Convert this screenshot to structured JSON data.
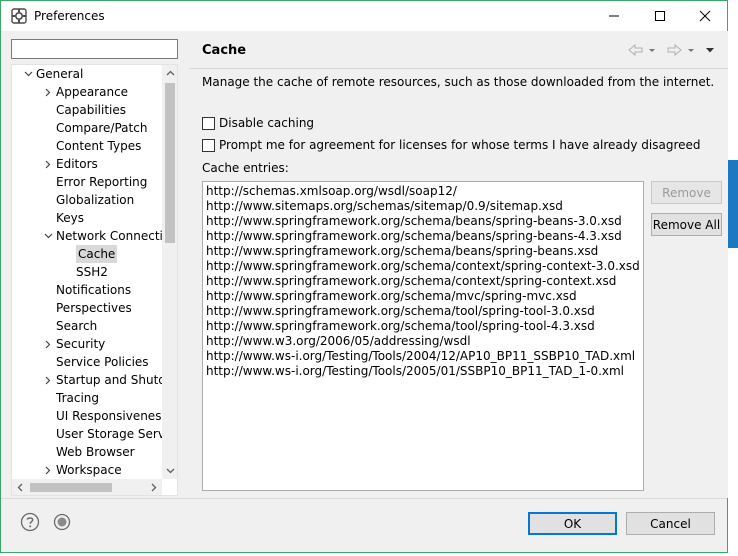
{
  "window": {
    "title": "Preferences"
  },
  "filter": {
    "value": ""
  },
  "tree": {
    "items": [
      {
        "label": "General",
        "level": 0,
        "arrow": "expanded"
      },
      {
        "label": "Appearance",
        "level": 1,
        "arrow": "collapsed"
      },
      {
        "label": "Capabilities",
        "level": 1,
        "arrow": "none"
      },
      {
        "label": "Compare/Patch",
        "level": 1,
        "arrow": "none"
      },
      {
        "label": "Content Types",
        "level": 1,
        "arrow": "none"
      },
      {
        "label": "Editors",
        "level": 1,
        "arrow": "collapsed"
      },
      {
        "label": "Error Reporting",
        "level": 1,
        "arrow": "none"
      },
      {
        "label": "Globalization",
        "level": 1,
        "arrow": "none"
      },
      {
        "label": "Keys",
        "level": 1,
        "arrow": "none"
      },
      {
        "label": "Network Connection",
        "level": 1,
        "arrow": "expanded"
      },
      {
        "label": "Cache",
        "level": 2,
        "arrow": "none",
        "selected": true
      },
      {
        "label": "SSH2",
        "level": 2,
        "arrow": "none"
      },
      {
        "label": "Notifications",
        "level": 1,
        "arrow": "none"
      },
      {
        "label": "Perspectives",
        "level": 1,
        "arrow": "none"
      },
      {
        "label": "Search",
        "level": 1,
        "arrow": "none"
      },
      {
        "label": "Security",
        "level": 1,
        "arrow": "collapsed"
      },
      {
        "label": "Service Policies",
        "level": 1,
        "arrow": "none"
      },
      {
        "label": "Startup and Shutdown",
        "level": 1,
        "arrow": "collapsed"
      },
      {
        "label": "Tracing",
        "level": 1,
        "arrow": "none"
      },
      {
        "label": "UI Responsiveness Monitoring",
        "level": 1,
        "arrow": "none"
      },
      {
        "label": "User Storage Service",
        "level": 1,
        "arrow": "none"
      },
      {
        "label": "Web Browser",
        "level": 1,
        "arrow": "none"
      },
      {
        "label": "Workspace",
        "level": 1,
        "arrow": "collapsed"
      }
    ]
  },
  "page": {
    "title": "Cache",
    "description": "Manage the cache of remote resources, such as those downloaded from the internet.",
    "disable_caching_label": "Disable caching",
    "disable_caching_checked": false,
    "prompt_label": "Prompt me for agreement for licenses for whose terms I have already disagreed",
    "prompt_checked": false,
    "entries_label": "Cache entries:",
    "entries": [
      "http://schemas.xmlsoap.org/wsdl/soap12/",
      "http://www.sitemaps.org/schemas/sitemap/0.9/sitemap.xsd",
      "http://www.springframework.org/schema/beans/spring-beans-3.0.xsd",
      "http://www.springframework.org/schema/beans/spring-beans-4.3.xsd",
      "http://www.springframework.org/schema/beans/spring-beans.xsd",
      "http://www.springframework.org/schema/context/spring-context-3.0.xsd",
      "http://www.springframework.org/schema/context/spring-context.xsd",
      "http://www.springframework.org/schema/mvc/spring-mvc.xsd",
      "http://www.springframework.org/schema/tool/spring-tool-3.0.xsd",
      "http://www.springframework.org/schema/tool/spring-tool-4.3.xsd",
      "http://www.w3.org/2006/05/addressing/wsdl",
      "http://www.ws-i.org/Testing/Tools/2004/12/AP10_BP11_SSBP10_TAD.xml",
      "http://www.ws-i.org/Testing/Tools/2005/01/SSBP10_BP11_TAD_1-0.xml"
    ],
    "remove_label": "Remove",
    "remove_all_label": "Remove All"
  },
  "buttons": {
    "ok": "OK",
    "cancel": "Cancel"
  },
  "colors": {
    "accent": "#0078d7",
    "window_border": "#3aa76b"
  }
}
